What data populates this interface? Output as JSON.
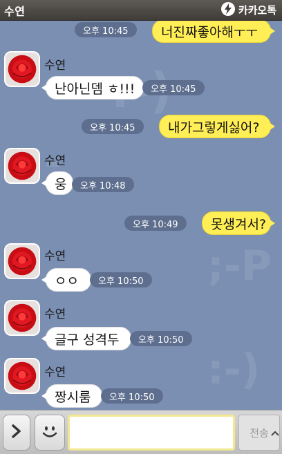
{
  "window": {
    "contact_name": "수연",
    "app_name": "카카오톡"
  },
  "messages": [
    {
      "from": "me",
      "text": "너진짜좋아해ㅜㅜ",
      "time": "오후 10:45"
    },
    {
      "from": "other",
      "sender": "수연",
      "text": "난아닌뎀 ㅎ!!!",
      "time": "오후 10:45"
    },
    {
      "from": "me",
      "text": "내가그렇게싫어?",
      "time": "오후 10:45"
    },
    {
      "from": "other",
      "sender": "수연",
      "text": "웅",
      "time": "오후 10:48"
    },
    {
      "from": "me",
      "text": "못생겨서?",
      "time": "오후 10:49"
    },
    {
      "from": "other",
      "sender": "수연",
      "text": "ㅇㅇ",
      "time": "오후 10:50"
    },
    {
      "from": "other",
      "sender": "수연",
      "text": "글구 성격두",
      "time": "오후 10:50"
    },
    {
      "from": "other",
      "sender": "수연",
      "text": "짱시룸",
      "time": "오후 10:50"
    }
  ],
  "input": {
    "value": "",
    "send_label": "전송"
  },
  "icons": {
    "expand": "chevron-right-icon",
    "emoticon": "smiley-icon",
    "brand": "kakaotalk-logo-icon",
    "scroll": "chevron-up-icon"
  },
  "colors": {
    "my_bubble": "#ffee55",
    "other_bubble": "#ffffff",
    "background": "#7b8fb2"
  }
}
